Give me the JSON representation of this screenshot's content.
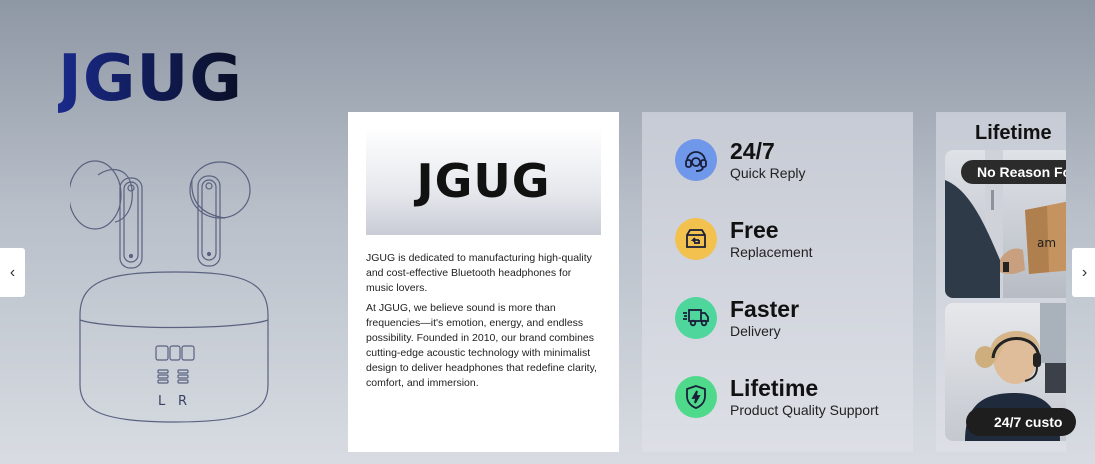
{
  "brand": {
    "logo_text": "JGUG"
  },
  "earbuds_image": {
    "case_labels": [
      "L",
      "R"
    ]
  },
  "about": {
    "banner_logo": "JGUG",
    "paragraph1": "JGUG is dedicated to manufacturing high-quality and cost-effective Bluetooth headphones for music lovers.",
    "paragraph2": "At JGUG, we believe sound is more than frequencies—it's emotion, energy, and endless possibility. Founded in 2010, our brand combines cutting-edge acoustic technology with minimalist design to deliver headphones that redefine clarity, comfort, and immersion."
  },
  "features": [
    {
      "title": "24/7",
      "subtitle": "Quick Reply",
      "icon": "headset-support-icon",
      "color": "#6f97ea"
    },
    {
      "title": "Free",
      "subtitle": "Replacement",
      "icon": "box-return-icon",
      "color": "#f2c14e"
    },
    {
      "title": "Faster",
      "subtitle": "Delivery",
      "icon": "delivery-truck-icon",
      "color": "#4fd69c"
    },
    {
      "title": "Lifetime",
      "subtitle": "Product Quality Support",
      "icon": "shield-bolt-icon",
      "color": "#4fd98a"
    }
  ],
  "promo": {
    "title": "Lifetime",
    "pill_top": "No Reason Fo",
    "pill_bottom": "24/7 custo",
    "box_text": "am"
  },
  "carousel": {
    "prev_icon": "chevron-left-icon",
    "next_icon": "chevron-right-icon"
  }
}
